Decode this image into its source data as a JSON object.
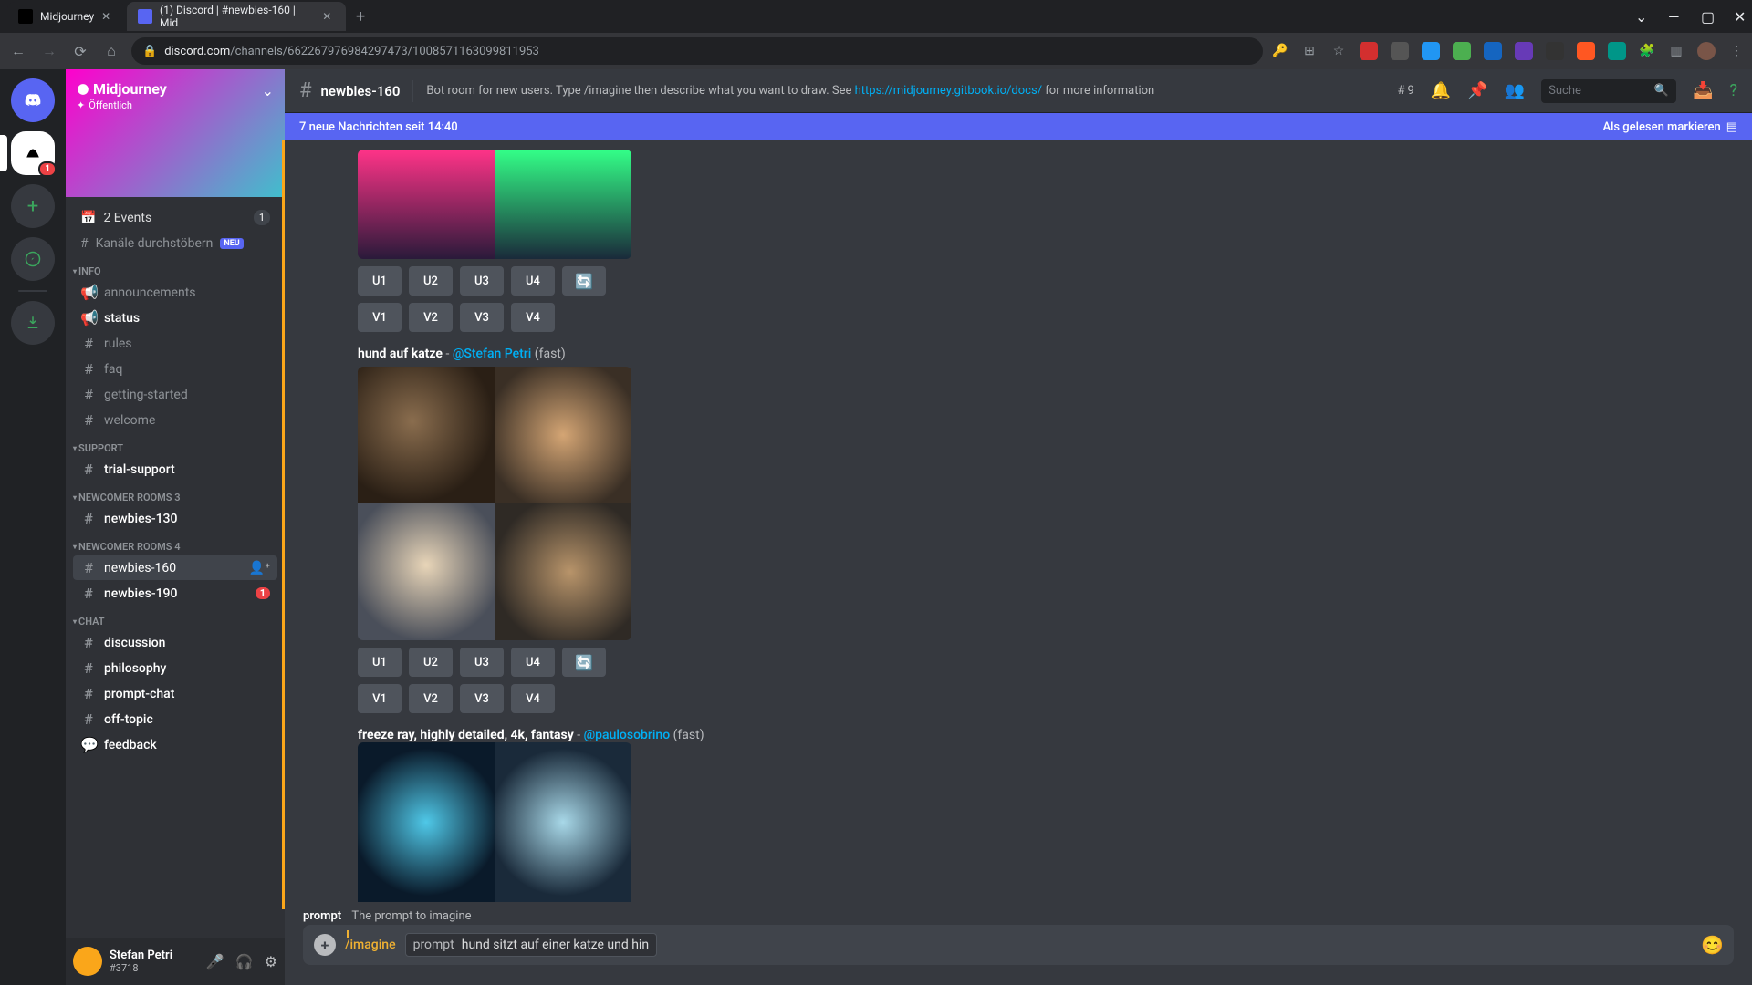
{
  "browser": {
    "tabs": [
      {
        "title": "Midjourney",
        "active": false
      },
      {
        "title": "(1) Discord | #newbies-160 | Mid",
        "active": true
      }
    ],
    "url_domain": "discord.com",
    "url_path": "/channels/662267976984297473/1008571163099811953"
  },
  "server": {
    "name": "Midjourney",
    "visibility": "Öffentlich"
  },
  "events": {
    "label": "2 Events",
    "badge": "1"
  },
  "browse_channels": "Kanäle durchstöbern",
  "browse_badge": "NEU",
  "categories": {
    "info": {
      "label": "INFO",
      "channels": [
        {
          "name": "announcements",
          "type": "announce"
        },
        {
          "name": "status",
          "type": "announce",
          "unread": true
        },
        {
          "name": "rules",
          "type": "text"
        },
        {
          "name": "faq",
          "type": "text"
        },
        {
          "name": "getting-started",
          "type": "text"
        },
        {
          "name": "welcome",
          "type": "text"
        }
      ]
    },
    "support": {
      "label": "SUPPORT",
      "channels": [
        {
          "name": "trial-support",
          "type": "text",
          "unread": true
        }
      ]
    },
    "newcomer3": {
      "label": "NEWCOMER ROOMS 3",
      "channels": [
        {
          "name": "newbies-130",
          "type": "text",
          "unread": true
        }
      ]
    },
    "newcomer4": {
      "label": "NEWCOMER ROOMS 4",
      "channels": [
        {
          "name": "newbies-160",
          "type": "text",
          "selected": true
        },
        {
          "name": "newbies-190",
          "type": "text",
          "unread": true,
          "badge": "1"
        }
      ]
    },
    "chat": {
      "label": "CHAT",
      "channels": [
        {
          "name": "discussion",
          "type": "text",
          "unread": true
        },
        {
          "name": "philosophy",
          "type": "text",
          "unread": true
        },
        {
          "name": "prompt-chat",
          "type": "text",
          "unread": true
        },
        {
          "name": "off-topic",
          "type": "text",
          "unread": true
        },
        {
          "name": "feedback",
          "type": "forum",
          "unread": true
        }
      ]
    }
  },
  "user": {
    "name": "Stefan Petri",
    "tag": "#3718"
  },
  "header": {
    "channel": "newbies-160",
    "topic_pre": "Bot room for new users. Type /imagine then describe what you want to draw. See ",
    "topic_link": "https://midjourney.gitbook.io/docs/",
    "topic_post": " for more information",
    "threads_count": "9",
    "search_placeholder": "Suche"
  },
  "banner": {
    "text": "7 neue Nachrichten seit 14:40",
    "mark": "Als gelesen markieren"
  },
  "buttons": {
    "u1": "U1",
    "u2": "U2",
    "u3": "U3",
    "u4": "U4",
    "v1": "V1",
    "v2": "V2",
    "v3": "V3",
    "v4": "V4"
  },
  "messages": {
    "m1": {
      "prompt": "hund auf katze",
      "user": "@Stefan Petri",
      "meta": "(fast)"
    },
    "m2": {
      "prompt": "freeze ray, highly detailed, 4k, fantasy",
      "user": "@paulosobrino",
      "meta": "(fast)"
    }
  },
  "cmd_hint": {
    "label": "prompt",
    "desc": "The prompt to imagine"
  },
  "input": {
    "command": "/imagine",
    "param_label": "prompt",
    "param_value": "hund sitzt auf einer katze und hin"
  }
}
